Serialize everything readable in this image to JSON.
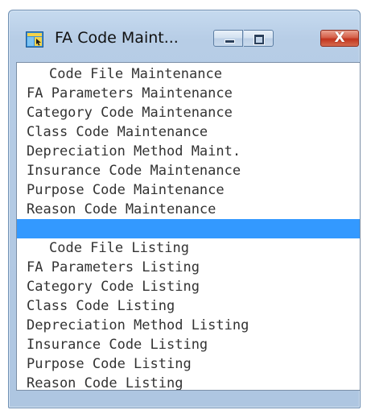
{
  "window": {
    "title": "FA Code Maint...",
    "controls": {
      "minimize": "minimize-icon",
      "maximize": "maximize-icon",
      "close": "close-icon",
      "close_glyph": "X"
    }
  },
  "list": {
    "items": [
      {
        "label": "Code File Maintenance",
        "kind": "header"
      },
      {
        "label": "FA Parameters Maintenance",
        "kind": "item"
      },
      {
        "label": "Category Code Maintenance",
        "kind": "item"
      },
      {
        "label": "Class Code Maintenance",
        "kind": "item"
      },
      {
        "label": "Depreciation Method Maint.",
        "kind": "item"
      },
      {
        "label": "Insurance Code Maintenance",
        "kind": "item"
      },
      {
        "label": "Purpose Code Maintenance",
        "kind": "item"
      },
      {
        "label": "Reason Code Maintenance",
        "kind": "item"
      },
      {
        "label": "",
        "kind": "selected-blank"
      },
      {
        "label": "Code File Listing",
        "kind": "header"
      },
      {
        "label": "FA Parameters Listing",
        "kind": "item"
      },
      {
        "label": "Category Code Listing",
        "kind": "item"
      },
      {
        "label": "Class Code Listing",
        "kind": "item"
      },
      {
        "label": "Depreciation Method Listing",
        "kind": "item"
      },
      {
        "label": "Insurance Code Listing",
        "kind": "item"
      },
      {
        "label": "Purpose Code Listing",
        "kind": "item"
      },
      {
        "label": "Reason Code Listing",
        "kind": "item"
      }
    ],
    "selected_index": 8
  },
  "colors": {
    "selection": "#3399ff",
    "text": "#333333",
    "frame": "#b7cde6",
    "close_button": "#c2341d"
  }
}
